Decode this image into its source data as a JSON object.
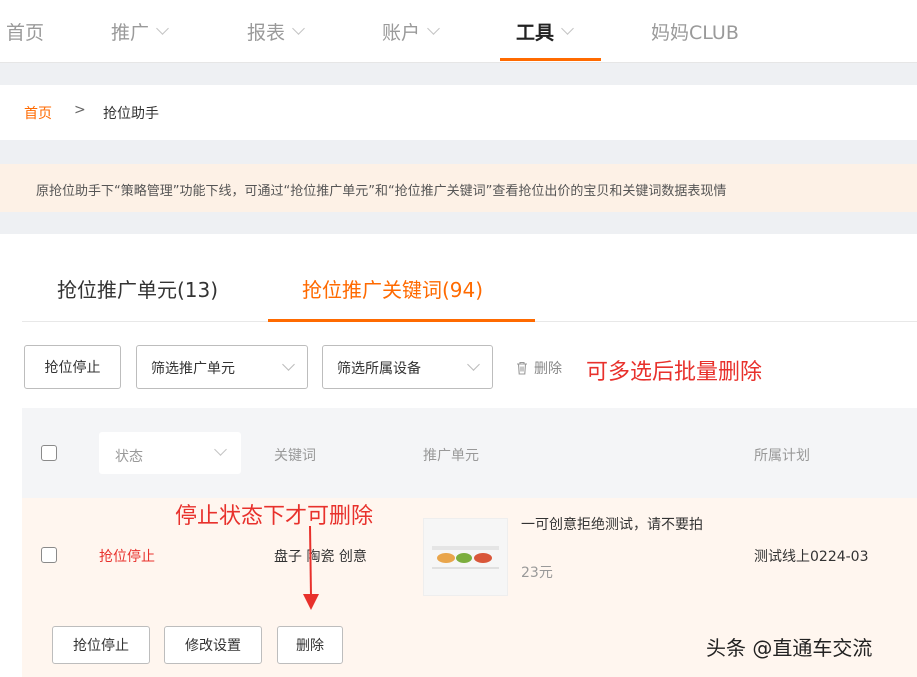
{
  "nav": {
    "items": [
      {
        "label": "首页",
        "has_dropdown": false
      },
      {
        "label": "推广",
        "has_dropdown": true
      },
      {
        "label": "报表",
        "has_dropdown": true
      },
      {
        "label": "账户",
        "has_dropdown": true
      },
      {
        "label": "工具",
        "has_dropdown": true,
        "active": true
      },
      {
        "label": "妈妈CLUB",
        "has_dropdown": false
      }
    ]
  },
  "breadcrumb": {
    "home": "首页",
    "separator": ">",
    "current": "抢位助手"
  },
  "notice": {
    "text": "原抢位助手下“策略管理”功能下线，可通过“抢位推广单元”和“抢位推广关键词”查看抢位出价的宝贝和关键词数据表现情"
  },
  "tabs": [
    {
      "label": "抢位推广单元(13)",
      "active": false
    },
    {
      "label": "抢位推广关键词(94)",
      "active": true
    }
  ],
  "toolbar": {
    "stop_label": "抢位停止",
    "filter_unit_label": "筛选推广单元",
    "filter_device_label": "筛选所属设备",
    "delete_label": "删除"
  },
  "annotations": {
    "batch_delete_note": "可多选后批量删除",
    "stop_first_note": "停止状态下才可删除"
  },
  "table": {
    "headers": {
      "status": "状态",
      "keyword": "关键词",
      "unit": "推广单元",
      "plan": "所属计划"
    },
    "rows": [
      {
        "status": "抢位停止",
        "keyword": "盘子 陶瓷 创意",
        "unit_title": "一可创意拒绝测试，请不要拍",
        "unit_price": "23元",
        "plan": "测试线上0224-03"
      }
    ]
  },
  "row_actions": {
    "stop_label": "抢位停止",
    "edit_label": "修改设置",
    "delete_label": "删除"
  },
  "watermark": "头条 @直通车交流",
  "colors": {
    "accent": "#ff6a00",
    "annotation_red": "#e8312c",
    "row_highlight": "#fff6ef",
    "notice_bg": "#fdf1e6"
  }
}
